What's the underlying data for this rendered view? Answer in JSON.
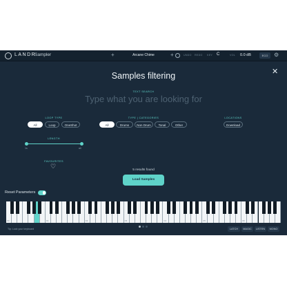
{
  "topbar": {
    "brand": "LANDR",
    "app_name": "Sampler",
    "preset": "Arcane Chime",
    "labels": [
      "UNDO",
      "REDO",
      "KEY",
      "VOL"
    ],
    "key": "C",
    "volume": "0.0 dB",
    "box_label": "ECO"
  },
  "panel": {
    "title": "Samples filtering",
    "text_search_label": "TEXT SEARCH",
    "search_placeholder": "Type what you are looking for",
    "loop_type_label": "LOOP TYPE",
    "loop_types": [
      "All",
      "Loop",
      "OneShot"
    ],
    "type_label": "TYPE | CATEGORIES",
    "types": [
      "All",
      "Drums",
      "Non Drum",
      "Tonal",
      "Other"
    ],
    "locations_label": "LOCATIONS",
    "location": "Download",
    "length_label": "LENGTH",
    "length_min": "1s",
    "length_max": "all",
    "favourites_label": "FAVOURITES",
    "results": "5 results found",
    "load_button": "Load Samples"
  },
  "reset": {
    "label": "Reset Parameters",
    "enabled": true
  },
  "keyboard": {
    "octave_labels": [
      "C0",
      "C1",
      "C2",
      "C3",
      "C4",
      "C5",
      "C6"
    ],
    "highlighted_key": "A0",
    "hint": "Tip: Lock your keyboard",
    "page_count": 3,
    "active_page": 1,
    "modes": [
      "LATCH",
      "MAGIC",
      "LISTEN",
      "MONO"
    ]
  },
  "colors": {
    "accent": "#5fd3c9",
    "background": "#1a2a3a",
    "topbar": "#14222f"
  },
  "icons": {
    "logo": "landr-logo-icon",
    "close": "close-icon",
    "favourite": "heart-icon",
    "settings": "gear-icon"
  }
}
